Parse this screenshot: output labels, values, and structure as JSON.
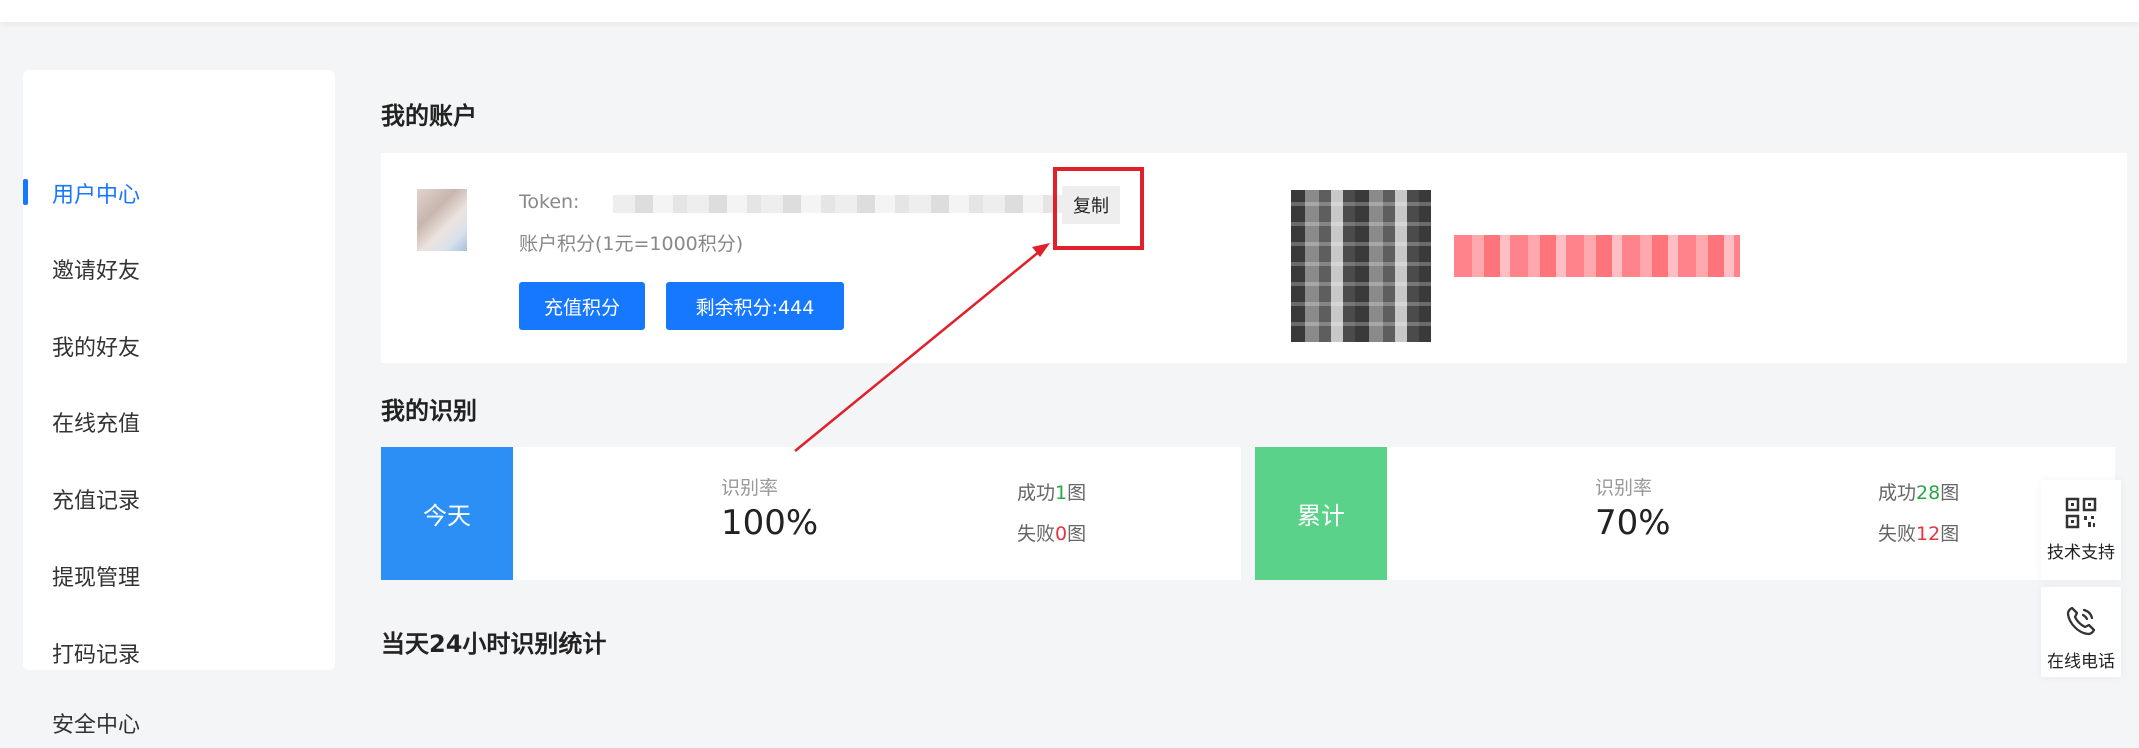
{
  "sidebar": {
    "items": [
      {
        "label": "用户中心",
        "active": true
      },
      {
        "label": "邀请好友",
        "active": false
      },
      {
        "label": "我的好友",
        "active": false
      },
      {
        "label": "在线充值",
        "active": false
      },
      {
        "label": "充值记录",
        "active": false
      },
      {
        "label": "提现管理",
        "active": false
      },
      {
        "label": "打码记录",
        "active": false
      },
      {
        "label": "安全中心",
        "active": false
      }
    ]
  },
  "account": {
    "title": "我的账户",
    "token_label": "Token:",
    "copy_label": "复制",
    "points_note": "账户积分(1元=1000积分)",
    "recharge_label": "充值积分",
    "remaining_label": "剩余积分:444"
  },
  "recognition": {
    "title": "我的识别",
    "today": {
      "tag": "今天",
      "rate_label": "识别率",
      "rate": "100%",
      "success_prefix": "成功",
      "success_count": "1",
      "fail_prefix": "失败",
      "fail_count": "0",
      "unit": "图"
    },
    "total": {
      "tag": "累计",
      "rate_label": "识别率",
      "rate": "70%",
      "success_prefix": "成功",
      "success_count": "28",
      "fail_prefix": "失败",
      "fail_count": "12",
      "unit": "图"
    }
  },
  "stats24": {
    "title": "当天24小时识别统计"
  },
  "float": {
    "support_label": "技术支持",
    "phone_label": "在线电话"
  },
  "colors": {
    "accent": "#1677ff",
    "today_tag": "#2b8ff5",
    "total_tag": "#5bd289",
    "annotation": "#e0202a"
  },
  "icons": [
    "qr-code-icon",
    "phone-icon"
  ]
}
